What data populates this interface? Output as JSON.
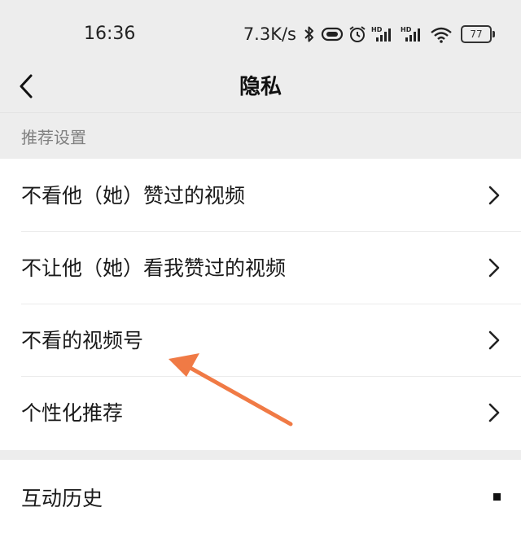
{
  "status_bar": {
    "time": "16:36",
    "net_speed": "7.3K/s",
    "battery_level": "77",
    "icons": [
      "bluetooth-icon",
      "vibrate-icon",
      "alarm-icon",
      "hd-signal-icon",
      "hd-signal-icon",
      "wifi-icon",
      "battery-icon"
    ]
  },
  "nav": {
    "title": "隐私",
    "back_icon": "chevron-left-icon"
  },
  "section": {
    "label": "推荐设置"
  },
  "items": [
    {
      "label": "不看他（她）赞过的视频"
    },
    {
      "label": "不让他（她）看我赞过的视频"
    },
    {
      "label": "不看的视频号"
    },
    {
      "label": "个性化推荐"
    }
  ],
  "items2": [
    {
      "label": "互动历史"
    }
  ],
  "colors": {
    "background": "#ededed",
    "card": "#ffffff",
    "annotation_arrow": "#f07a45"
  }
}
